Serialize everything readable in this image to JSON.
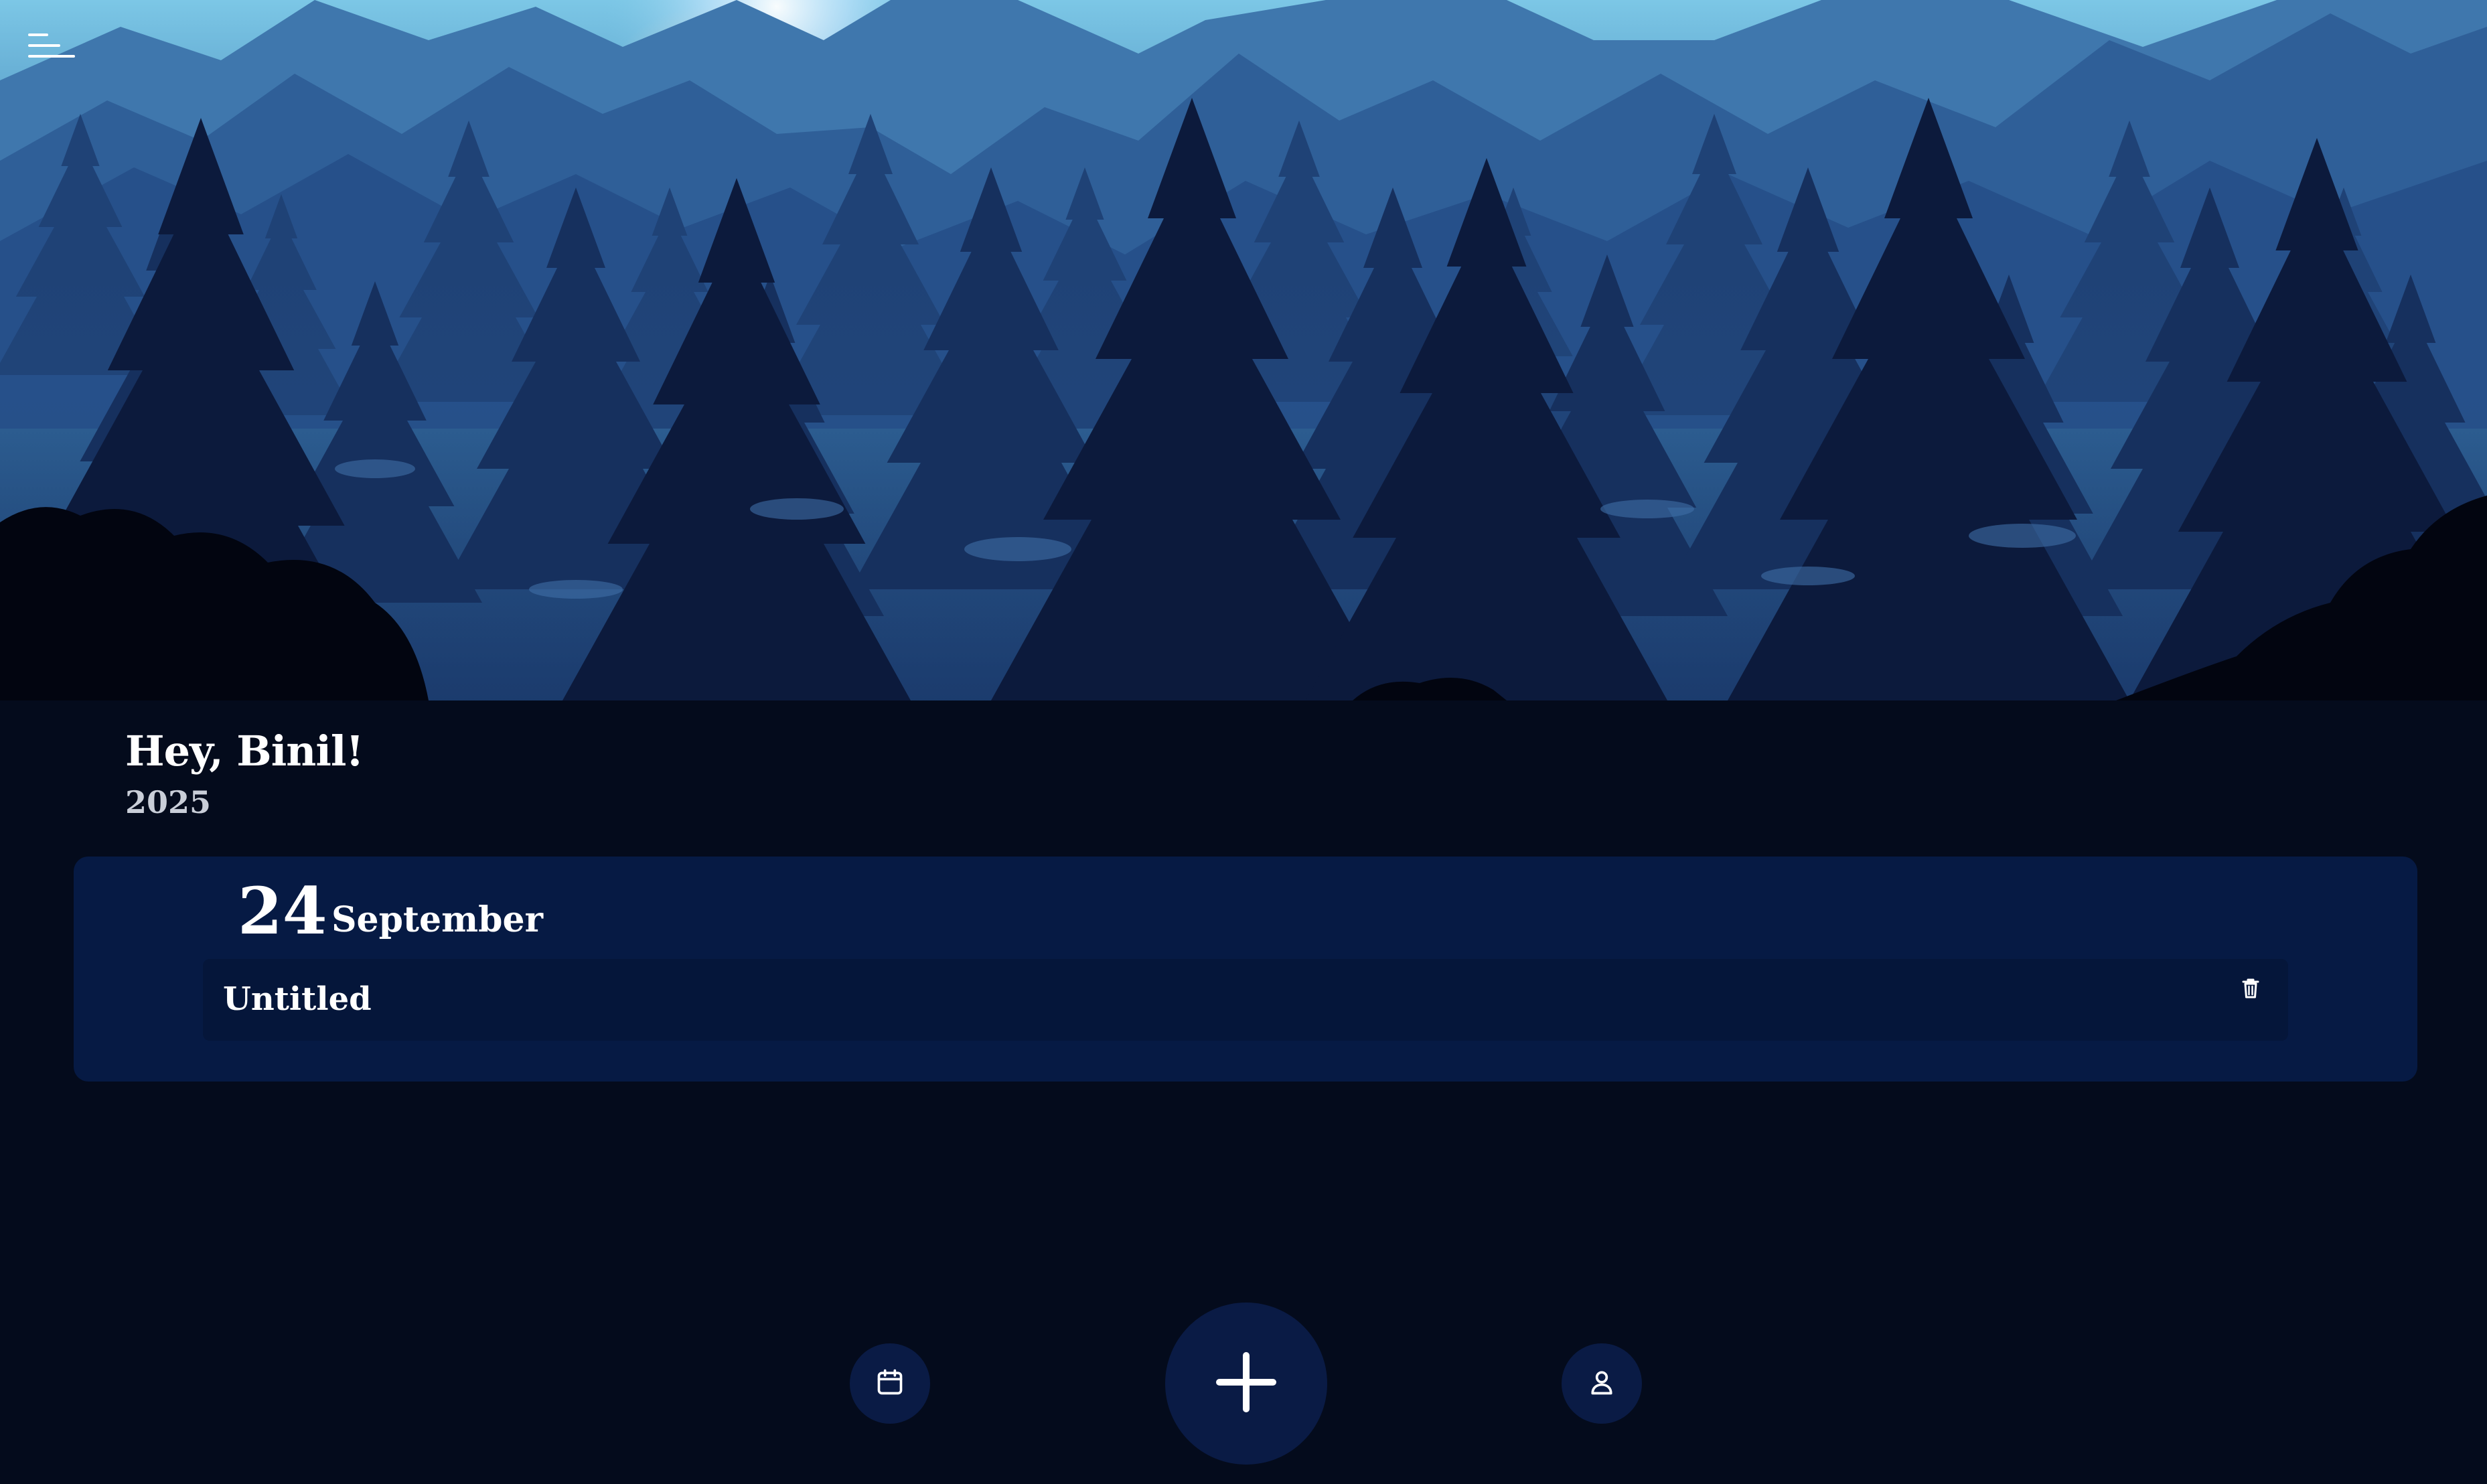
{
  "header": {
    "menu_icon": "hamburger-menu-icon",
    "hero_image": "night-mountain-forest-illustration"
  },
  "greeting": {
    "text": "Hey, Binil!",
    "year": "2025"
  },
  "day_groups": [
    {
      "day": "24",
      "month": "September",
      "entries": [
        {
          "title": "Untitled",
          "action_icon": "trash-icon"
        }
      ]
    }
  ],
  "bottom_nav": {
    "left_icon": "calendar-icon",
    "center_icon": "plus-icon",
    "right_icon": "user-icon"
  },
  "colors": {
    "background": "#040b1c",
    "card": "#061a44",
    "entry": "#05163a",
    "nav_button": "#0a1b45",
    "text": "#ffffff",
    "subtext": "#c9ced8"
  }
}
